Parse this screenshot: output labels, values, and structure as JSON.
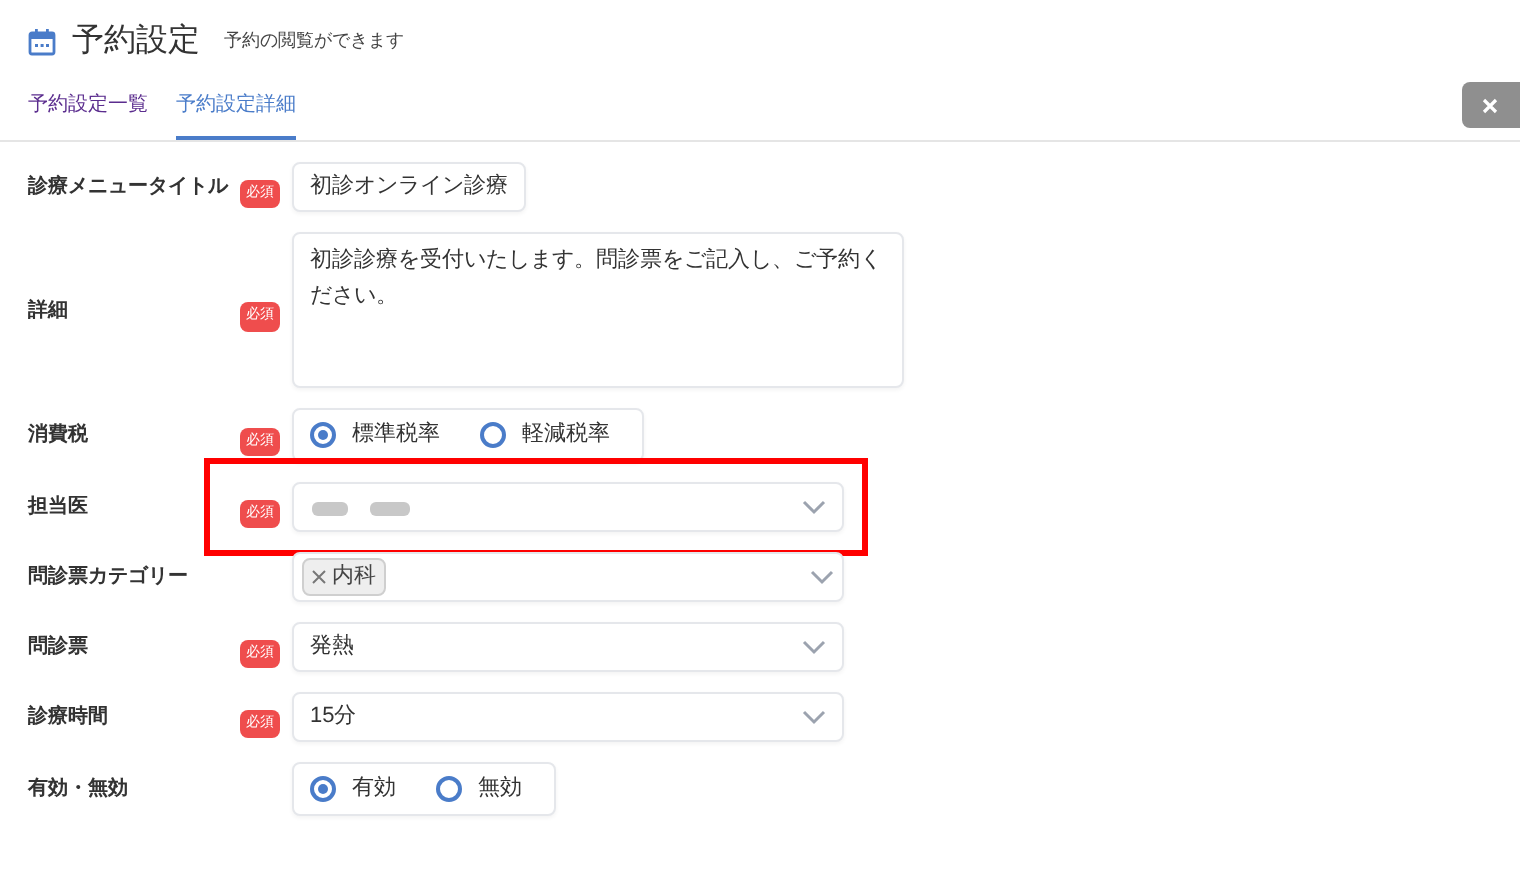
{
  "header": {
    "title": "予約設定",
    "subtitle": "予約の閲覧ができます"
  },
  "tabs": [
    {
      "label": "予約設定一覧",
      "selected": false
    },
    {
      "label": "予約設定詳細",
      "selected": true
    }
  ],
  "fields": [
    {
      "label": "診療メニュータイトル",
      "badge": "必須",
      "kind": "text",
      "value": "初診オンライン診療"
    },
    {
      "label": "詳細",
      "badge": "必須",
      "kind": "textarea",
      "value": "初診診療を受付いたします。問診票をご記入し、ご予約ください。"
    },
    {
      "label": "消費税",
      "badge": "必須",
      "kind": "radio",
      "options": [
        {
          "label": "標準税率",
          "selected": true
        },
        {
          "label": "軽減税率",
          "selected": false
        }
      ]
    },
    {
      "label": "担当医",
      "badge": "必須",
      "kind": "blurred",
      "highlighted": true
    },
    {
      "label": "問診票カテゴリー",
      "kind": "tags",
      "tags": [
        "内科"
      ]
    },
    {
      "label": "問診票",
      "badge": "必須",
      "kind": "select",
      "value": "発熱"
    },
    {
      "label": "診療時間",
      "badge": "必須",
      "kind": "select",
      "value": "15分"
    },
    {
      "label": "有効・無効",
      "kind": "radio",
      "options": [
        {
          "label": "有効",
          "selected": true
        },
        {
          "label": "無効",
          "selected": false
        }
      ]
    }
  ]
}
